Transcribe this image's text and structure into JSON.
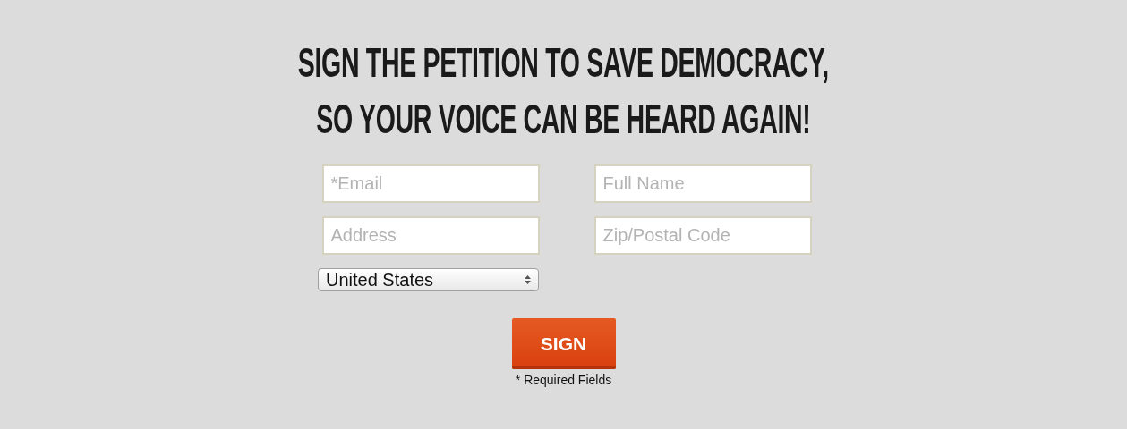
{
  "heading": [
    "SIGN THE PETITION TO SAVE DEMOCRACY,",
    "SO YOUR VOICE CAN BE HEARD AGAIN!"
  ],
  "fields": [
    {
      "placeholder": "*Email"
    },
    {
      "placeholder": "Full Name"
    },
    {
      "placeholder": "Address"
    },
    {
      "placeholder": "Zip/Postal Code"
    }
  ],
  "country_select": {
    "value": "United States"
  },
  "sign_button": "SIGN",
  "note": "* Required Fields"
}
